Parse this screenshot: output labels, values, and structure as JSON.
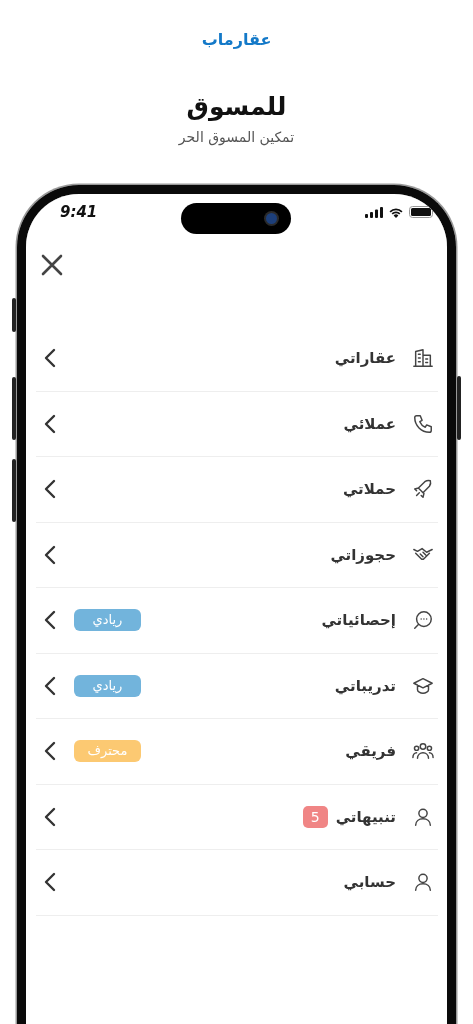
{
  "header": {
    "logo": "عقارماب",
    "title": "للمسوق",
    "subtitle": "تمكين المسوق الحر"
  },
  "status_bar": {
    "time": "9:41"
  },
  "menu": [
    {
      "label": "عقاراتي"
    },
    {
      "label": "عملائي"
    },
    {
      "label": "حملاتي"
    },
    {
      "label": "حجوزاتي"
    },
    {
      "label": "إحصائياتي",
      "badge": {
        "kind": "tag",
        "text": "ريادي",
        "color": "#72b4dc"
      }
    },
    {
      "label": "تدريباتي",
      "badge": {
        "kind": "tag",
        "text": "ريادي",
        "color": "#72b4dc"
      }
    },
    {
      "label": "فريقي",
      "badge": {
        "kind": "tag",
        "text": "محترف",
        "color": "#fcc972"
      }
    },
    {
      "label": "تنبيهاتي",
      "badge": {
        "kind": "count",
        "text": "5",
        "color": "#f08585"
      }
    },
    {
      "label": "حسابي"
    }
  ]
}
